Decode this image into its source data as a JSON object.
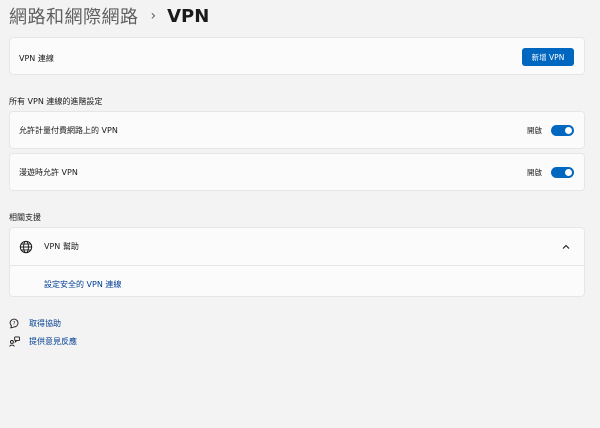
{
  "breadcrumb": {
    "parent": "網路和網際網路",
    "separator": "›",
    "current": "VPN"
  },
  "vpn_connections": {
    "label": "VPN 連線",
    "add_button": "新增 VPN"
  },
  "advanced": {
    "title": "所有 VPN 連線的進階設定",
    "rows": [
      {
        "label": "允許計量付費網路上的 VPN",
        "state": "開啟",
        "on": true
      },
      {
        "label": "漫遊時允許 VPN",
        "state": "開啟",
        "on": true
      }
    ]
  },
  "related": {
    "title": "相關支援",
    "help_title": "VPN 幫助",
    "help_link": "設定安全的 VPN 連線"
  },
  "footer": {
    "get_help": "取得協助",
    "feedback": "提供意見反應"
  },
  "colors": {
    "accent": "#0067c0",
    "link": "#003e92",
    "background": "#f3f3f3",
    "card": "#fbfbfb"
  },
  "icons": {
    "help": "globe-icon",
    "expand": "chevron-up-icon",
    "get_help": "help-chat-icon",
    "feedback": "feedback-icon"
  }
}
